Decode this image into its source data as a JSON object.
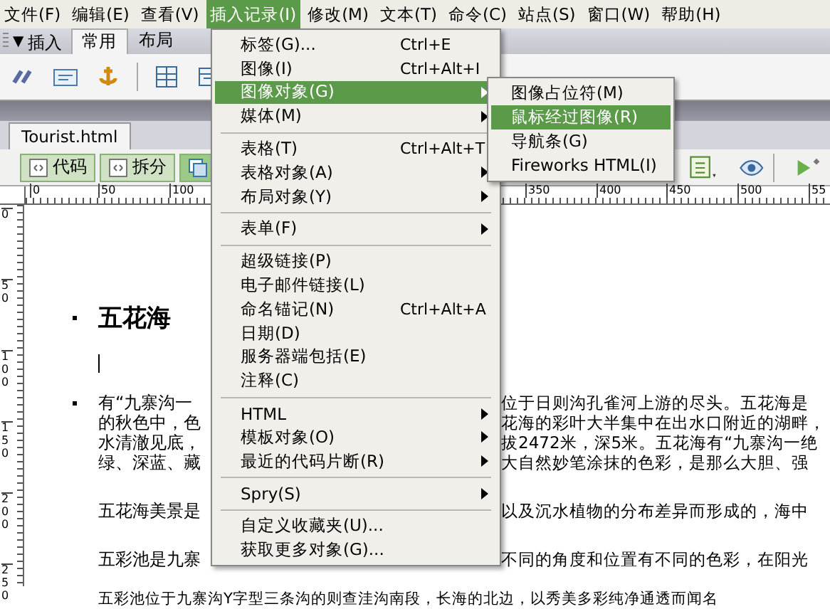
{
  "menubar": [
    {
      "label": "文件(F)",
      "selected": false
    },
    {
      "label": "编辑(E)",
      "selected": false
    },
    {
      "label": "查看(V)",
      "selected": false
    },
    {
      "label": "插入记录(I)",
      "selected": true
    },
    {
      "label": "修改(M)",
      "selected": false
    },
    {
      "label": "文本(T)",
      "selected": false
    },
    {
      "label": "命令(C)",
      "selected": false
    },
    {
      "label": "站点(S)",
      "selected": false
    },
    {
      "label": "窗口(W)",
      "selected": false
    },
    {
      "label": "帮助(H)",
      "selected": false
    }
  ],
  "insert_panel": {
    "toggle": "▼",
    "title": "插入",
    "tabs": [
      {
        "label": "常用",
        "selected": true
      },
      {
        "label": "布局",
        "selected": false
      }
    ]
  },
  "document_tab": "Tourist.html",
  "view_buttons": [
    {
      "label": "代码",
      "selected": false
    },
    {
      "label": "拆分",
      "selected": false
    }
  ],
  "top_ruler": [
    "0",
    "50",
    "100",
    "350",
    "400",
    "450",
    "500",
    "55"
  ],
  "left_ruler": [
    "0",
    "50",
    "100",
    "150",
    "200",
    "250"
  ],
  "document": {
    "heading": "五花海",
    "paragraphs": [
      {
        "bullet": true,
        "lines": [
          {
            "left": "有“九寨沟一",
            "right": "位于日则沟孔雀河上游的尽头。五花海是"
          },
          {
            "left": "的秋色中，色",
            "right": "花海的彩叶大半集中在出水口附近的湖畔，"
          },
          {
            "left": "水清澈见底，",
            "right": "拔2472米，深5米。五花海有“九寨沟一绝"
          },
          {
            "left": "绿、深蓝、藏",
            "right": "大自然妙笔涂抹的色彩，是那么大胆、强"
          }
        ]
      },
      {
        "bullet": false,
        "lines": [
          {
            "left": "五花海美景是",
            "right": "以及沉水植物的分布差异而形成的，海中"
          }
        ]
      },
      {
        "bullet": false,
        "lines": [
          {
            "left": "五彩池是九寨",
            "right": "不同的角度和位置有不同的色彩，在阳光"
          }
        ]
      },
      {
        "bullet": false,
        "lines": [
          {
            "left": "五彩池位于九寨沟Y字型三条沟的则查洼沟南段，长海的北边，以秀美多彩纯净通透而闻名"
          }
        ]
      }
    ]
  },
  "insert_menu": [
    {
      "kind": "item",
      "label": "标签(G)...",
      "shortcut": "Ctrl+E",
      "submenu": false,
      "selected": false
    },
    {
      "kind": "item",
      "label": "图像(I)",
      "shortcut": "Ctrl+Alt+I",
      "submenu": false,
      "selected": false
    },
    {
      "kind": "item",
      "label": "图像对象(G)",
      "submenu": true,
      "selected": true
    },
    {
      "kind": "item",
      "label": "媒体(M)",
      "submenu": true,
      "selected": false
    },
    {
      "kind": "separator"
    },
    {
      "kind": "item",
      "label": "表格(T)",
      "shortcut": "Ctrl+Alt+T",
      "submenu": false,
      "selected": false
    },
    {
      "kind": "item",
      "label": "表格对象(A)",
      "submenu": true,
      "selected": false
    },
    {
      "kind": "item",
      "label": "布局对象(Y)",
      "submenu": true,
      "selected": false
    },
    {
      "kind": "separator"
    },
    {
      "kind": "item",
      "label": "表单(F)",
      "submenu": true,
      "selected": false
    },
    {
      "kind": "separator"
    },
    {
      "kind": "item",
      "label": "超级链接(P)",
      "submenu": false,
      "selected": false
    },
    {
      "kind": "item",
      "label": "电子邮件链接(L)",
      "submenu": false,
      "selected": false
    },
    {
      "kind": "item",
      "label": "命名锚记(N)",
      "shortcut": "Ctrl+Alt+A",
      "submenu": false,
      "selected": false
    },
    {
      "kind": "item",
      "label": "日期(D)",
      "submenu": false,
      "selected": false
    },
    {
      "kind": "item",
      "label": "服务器端包括(E)",
      "submenu": false,
      "selected": false
    },
    {
      "kind": "item",
      "label": "注释(C)",
      "submenu": false,
      "selected": false
    },
    {
      "kind": "separator"
    },
    {
      "kind": "item",
      "label": "HTML",
      "submenu": true,
      "selected": false
    },
    {
      "kind": "item",
      "label": "模板对象(O)",
      "submenu": true,
      "selected": false
    },
    {
      "kind": "item",
      "label": "最近的代码片断(R)",
      "submenu": true,
      "selected": false
    },
    {
      "kind": "separator"
    },
    {
      "kind": "item",
      "label": "Spry(S)",
      "submenu": true,
      "selected": false
    },
    {
      "kind": "separator"
    },
    {
      "kind": "item",
      "label": "自定义收藏夹(U)...",
      "submenu": false,
      "selected": false
    },
    {
      "kind": "item",
      "label": "获取更多对象(G)...",
      "submenu": false,
      "selected": false
    }
  ],
  "image_objects_submenu": [
    {
      "label": "图像占位符(M)",
      "selected": false
    },
    {
      "label": "鼠标经过图像(R)",
      "selected": true
    },
    {
      "label": "导航条(G)",
      "selected": false
    },
    {
      "label": "Fireworks HTML(I)",
      "selected": false
    }
  ]
}
